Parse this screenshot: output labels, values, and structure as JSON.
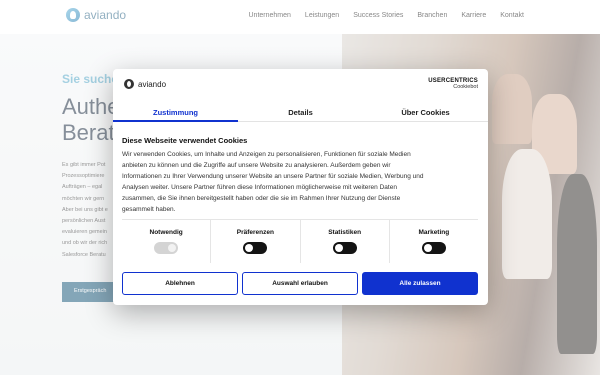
{
  "header": {
    "logo_text": "aviando",
    "nav": [
      "Unternehmen",
      "Leistungen",
      "Success Stories",
      "Branchen",
      "Karriere",
      "Kontakt"
    ]
  },
  "hero": {
    "subtitle": "Sie suche",
    "title_line1": "Authe",
    "title_line2": "Berat",
    "body_lines": [
      "Es gibt immer Pot",
      "Prozessoptimiere",
      "Aufträgen – egal",
      "möchten wir gern",
      "Aber bei uns gibt e",
      "persönlichen Aust",
      "evaluieren gemein",
      "und ob wir der rich",
      "Salesforce Beratu"
    ],
    "cta_label": "Erstgespräch"
  },
  "consent": {
    "logo_text": "aviando",
    "brand": "USERCENTRICS",
    "brand_sub": "Cookiebot",
    "tabs": [
      {
        "label": "Zustimmung",
        "active": true
      },
      {
        "label": "Details",
        "active": false
      },
      {
        "label": "Über Cookies",
        "active": false
      }
    ],
    "heading": "Diese Webseite verwendet Cookies",
    "text_lines": [
      "Wir verwenden Cookies, um Inhalte und Anzeigen zu personalisieren, Funktionen für soziale Medien",
      "anbieten zu können und die Zugriffe auf unsere Website zu analysieren. Außerdem geben wir",
      "Informationen zu Ihrer Verwendung unserer Website an unsere Partner für soziale Medien, Werbung und",
      "Analysen weiter. Unsere Partner führen diese Informationen möglicherweise mit weiteren Daten",
      "zusammen, die Sie ihnen bereitgestellt haben oder die sie im Rahmen Ihrer Nutzung der Dienste",
      "gesammelt haben."
    ],
    "toggles": [
      {
        "label": "Notwendig",
        "enabled": false
      },
      {
        "label": "Präferenzen",
        "enabled": true
      },
      {
        "label": "Statistiken",
        "enabled": true
      },
      {
        "label": "Marketing",
        "enabled": true
      }
    ],
    "buttons": {
      "deny": "Ablehnen",
      "selection": "Auswahl erlauben",
      "allow_all": "Alle zulassen"
    },
    "accent_color": "#1032cf"
  }
}
